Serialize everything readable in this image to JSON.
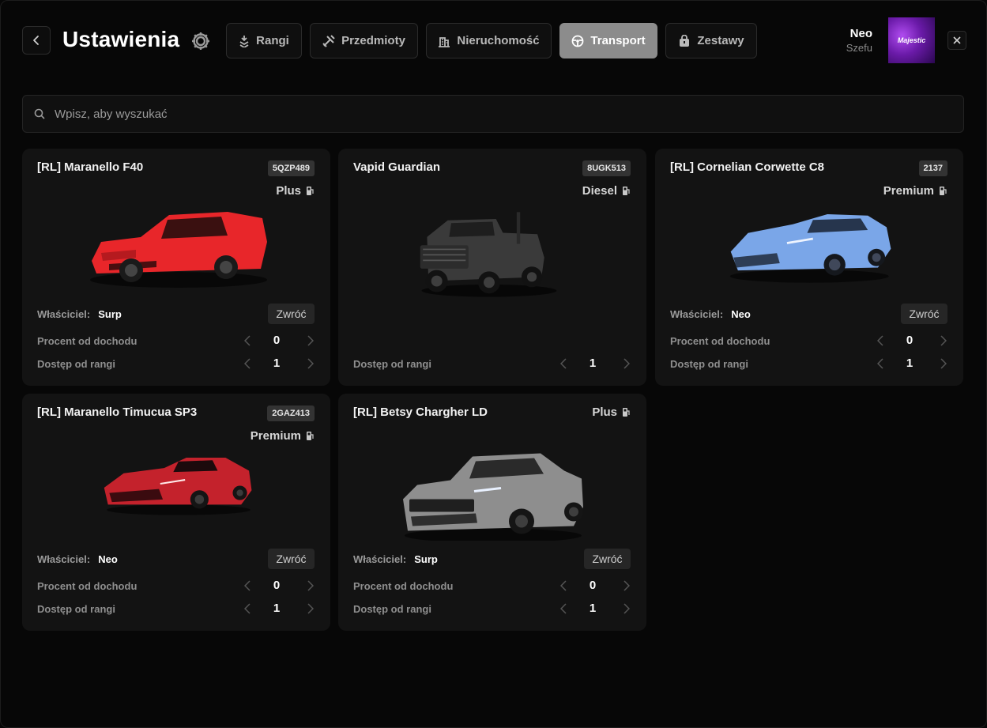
{
  "header": {
    "title": "Ustawienia",
    "tabs": [
      {
        "label": "Rangi",
        "icon": "rank-icon"
      },
      {
        "label": "Przedmioty",
        "icon": "tools-icon"
      },
      {
        "label": "Nieruchomość",
        "icon": "building-icon"
      },
      {
        "label": "Transport",
        "icon": "steering-wheel-icon",
        "active": true
      },
      {
        "label": "Zestawy",
        "icon": "bag-icon"
      }
    ],
    "user": {
      "name": "Neo",
      "role": "Szefu",
      "avatar_text": "Majestic"
    }
  },
  "search": {
    "placeholder": "Wpisz, aby wyszukać",
    "value": ""
  },
  "labels": {
    "owner": "Właściciel:",
    "return": "Zwróć",
    "income_percent": "Procent od dochodu",
    "rank_access": "Dostęp od rangi"
  },
  "vehicles": [
    {
      "name": "[RL] Maranello F40",
      "plate": "5QZP489",
      "fuel": "Plus",
      "owner": "Surp",
      "income_percent": "0",
      "rank_access": "1",
      "color": "#e8262a"
    },
    {
      "name": "Vapid Guardian",
      "plate": "8UGK513",
      "fuel": "Diesel",
      "rank_access": "1",
      "color": "#3a3a3a"
    },
    {
      "name": "[RL] Cornelian Corwette C8",
      "plate": "2137",
      "fuel": "Premium",
      "owner": "Neo",
      "income_percent": "0",
      "rank_access": "1",
      "color": "#7aa6e8"
    },
    {
      "name": "[RL] Maranello Timucua SP3",
      "plate": "2GAZ413",
      "fuel": "Premium",
      "owner": "Neo",
      "income_percent": "0",
      "rank_access": "1",
      "color": "#c4222c"
    },
    {
      "name": "[RL] Betsy Chargher LD",
      "fuel": "Plus",
      "owner": "Surp",
      "income_percent": "0",
      "rank_access": "1",
      "color": "#8e8e8e"
    }
  ]
}
